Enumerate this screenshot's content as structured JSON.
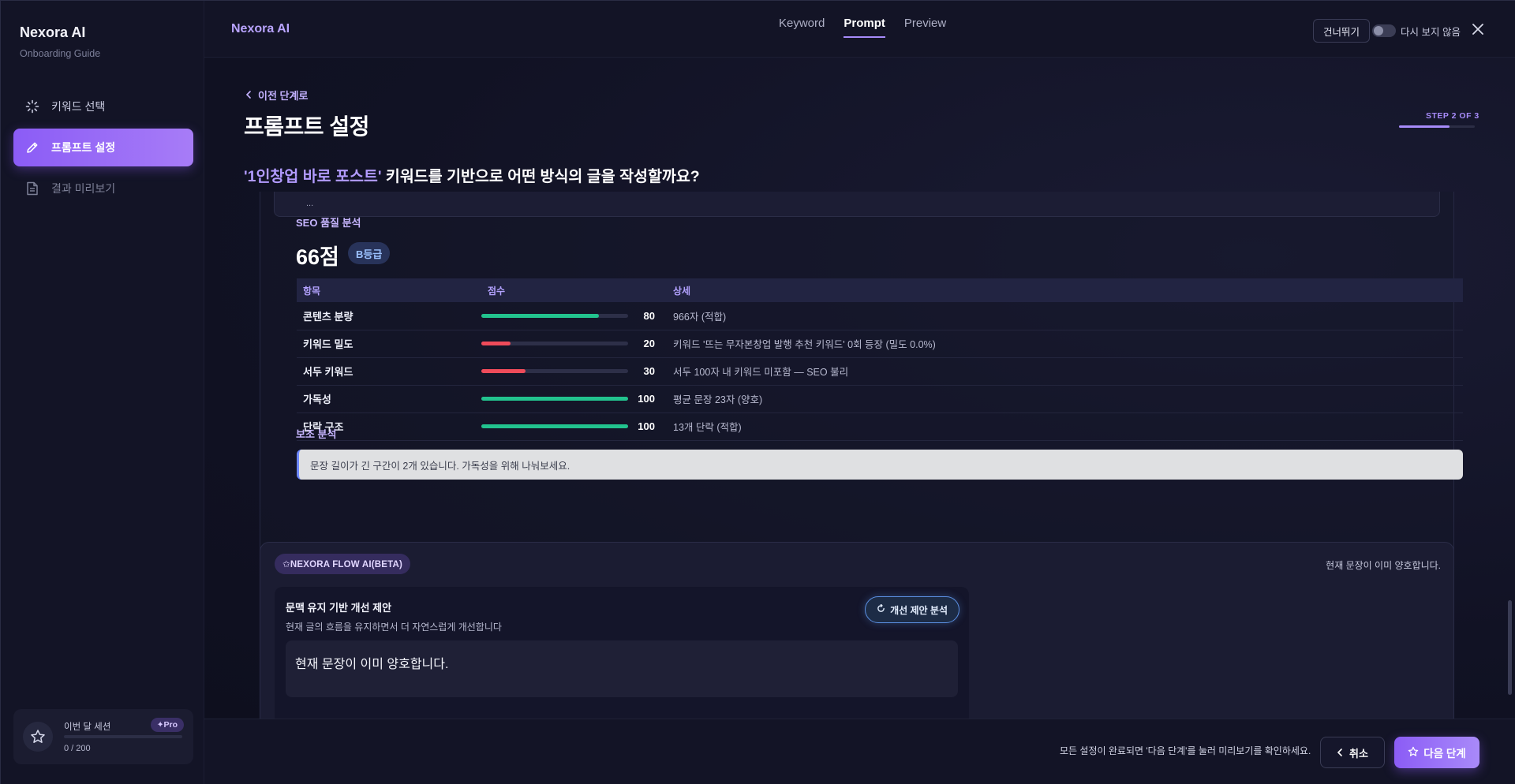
{
  "sidebar": {
    "brand_title": "Nexora AI",
    "brand_subtitle": "Onboarding Guide",
    "items": [
      {
        "label": "키워드 선택",
        "icon": "loader-icon"
      },
      {
        "label": "프롬프트 설정",
        "icon": "pencil-icon"
      },
      {
        "label": "결과 미리보기",
        "icon": "document-icon"
      }
    ],
    "session": {
      "label": "이번 달 세션",
      "badge": "✦Pro",
      "count": "0 / 200",
      "used": 0,
      "limit": 200
    }
  },
  "topbar": {
    "brand": "Nexora AI",
    "tabs": [
      "Keyword",
      "Prompt",
      "Preview"
    ],
    "active_tab": "Prompt",
    "skip_label": "건너뛰기",
    "toggle_label": "다시 보지 않음",
    "toggle_on": false
  },
  "header": {
    "back_label": "이전 단계로",
    "title": "프롬프트 설정",
    "step_label": "STEP 2 OF 3",
    "step_progress": 0.667,
    "question_keyword": "'1인창업 바로 포스트'",
    "question_rest": " 키워드를 기반으로 어떤 방식의 글을 작성할까요?"
  },
  "previous_box": {
    "ellipsis": "..."
  },
  "seo": {
    "label": "SEO 품질 분석",
    "score": "66점",
    "grade": "B등급",
    "columns": [
      "항목",
      "점수",
      "상세"
    ],
    "rows": [
      {
        "item": "콘텐츠 분량",
        "score": 80,
        "detail": "966자 (적합)",
        "color": "#22c38e"
      },
      {
        "item": "키워드 밀도",
        "score": 20,
        "detail": "키워드 '뜨는 무자본창업 발행 추천 키워드' 0회 등장 (밀도 0.0%)",
        "color": "#ef4b5a"
      },
      {
        "item": "서두 키워드",
        "score": 30,
        "detail": "서두 100자 내 키워드 미포함 — SEO 불리",
        "color": "#ef4b5a"
      },
      {
        "item": "가독성",
        "score": 100,
        "detail": "평균 문장 23자 (양호)",
        "color": "#22c38e"
      },
      {
        "item": "단락 구조",
        "score": 100,
        "detail": "13개 단락 (적합)",
        "color": "#22c38e"
      }
    ],
    "aux_label": "보조 분석",
    "aux_message": "문장 길이가 긴 구간이 2개 있습니다. 가독성을 위해 나눠보세요."
  },
  "flow": {
    "badge": "✩NEXORA FLOW AI(BETA)",
    "status": "현재 문장이 이미 양호합니다.",
    "suggest_title": "문맥 유지 기반 개선 제안",
    "suggest_desc": "현재 글의 흐름을 유지하면서 더 자연스럽게 개선합니다",
    "analyze_label": "개선 제안 분석",
    "suggest_text": "현재 문장이 이미 양호합니다."
  },
  "footer": {
    "hint": "모든 설정이 완료되면 '다음 단계'를 눌러 미리보기를 확인하세요.",
    "cancel_label": "취소",
    "next_label": "다음 단계"
  },
  "colors": {
    "accent": "#8b5cf6",
    "good": "#22c38e",
    "bad": "#ef4b5a"
  }
}
